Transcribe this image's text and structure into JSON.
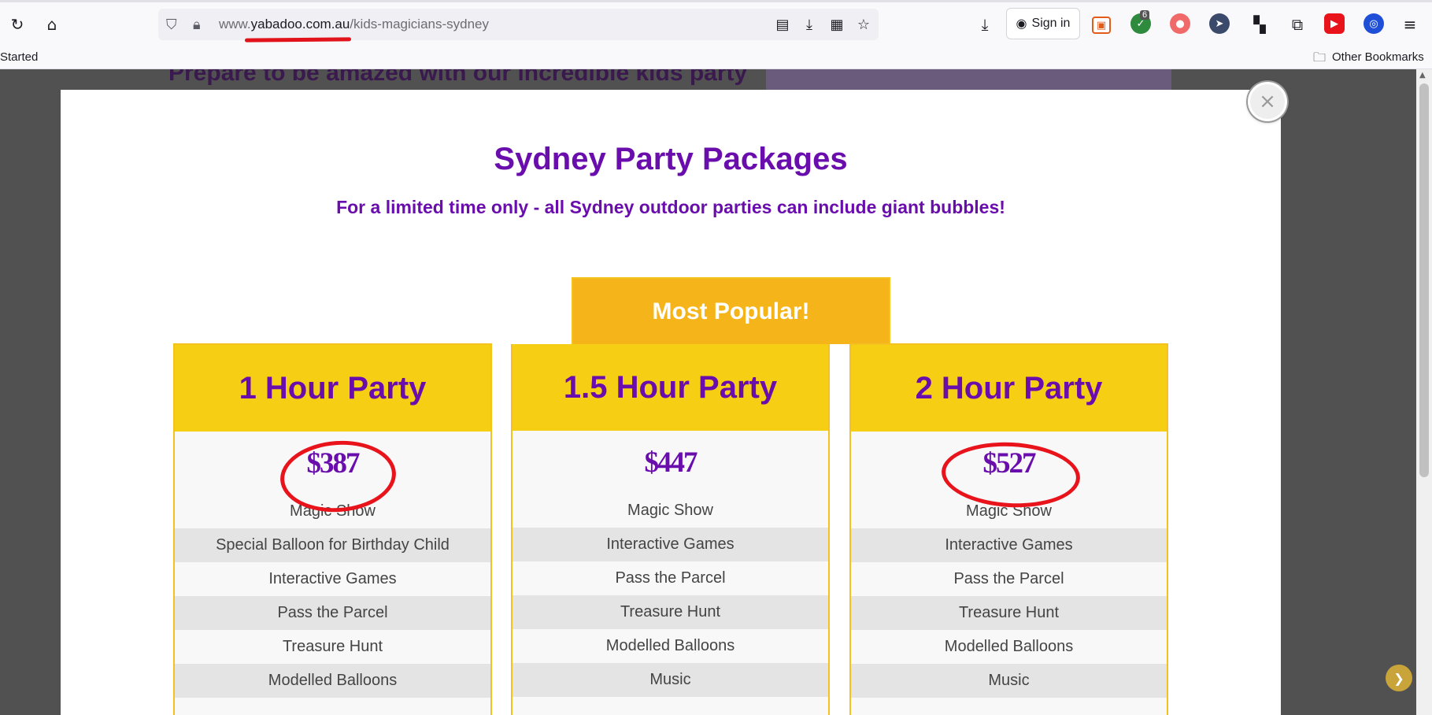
{
  "browser": {
    "url_prefix": "www.",
    "url_domain": "yabadoo.com.au",
    "url_path": "/kids-magicians-sydney",
    "sign_in_label": "Sign in",
    "extension_badge": "6",
    "bookmarks_left_item": "Started",
    "bookmarks_right_item": "Other Bookmarks"
  },
  "page_background": {
    "heading": "Prepare to be amazed with our incredible kids party"
  },
  "modal": {
    "title": "Sydney Party Packages",
    "subtitle": "For a limited time only - all Sydney outdoor parties can include giant bubbles!",
    "close_label": "×",
    "popular_label": "Most Popular!",
    "packages": [
      {
        "name": "1 Hour Party",
        "price": "$387",
        "features": [
          "Magic Show",
          "Special Balloon for Birthday Child",
          "Interactive Games",
          "Pass the Parcel",
          "Treasure Hunt",
          "Modelled Balloons"
        ]
      },
      {
        "name": "1.5 Hour Party",
        "price": "$447",
        "features": [
          "Magic Show",
          "Interactive Games",
          "Pass the Parcel",
          "Treasure Hunt",
          "Modelled Balloons",
          "Music"
        ]
      },
      {
        "name": "2 Hour Party",
        "price": "$527",
        "features": [
          "Magic Show",
          "Interactive Games",
          "Pass the Parcel",
          "Treasure Hunt",
          "Modelled Balloons",
          "Music"
        ]
      }
    ]
  },
  "colors": {
    "brand_purple": "#6a0dad",
    "header_yellow": "#f6cf15",
    "popular_orange": "#f5b51a",
    "annotation_red": "#e8131b"
  }
}
